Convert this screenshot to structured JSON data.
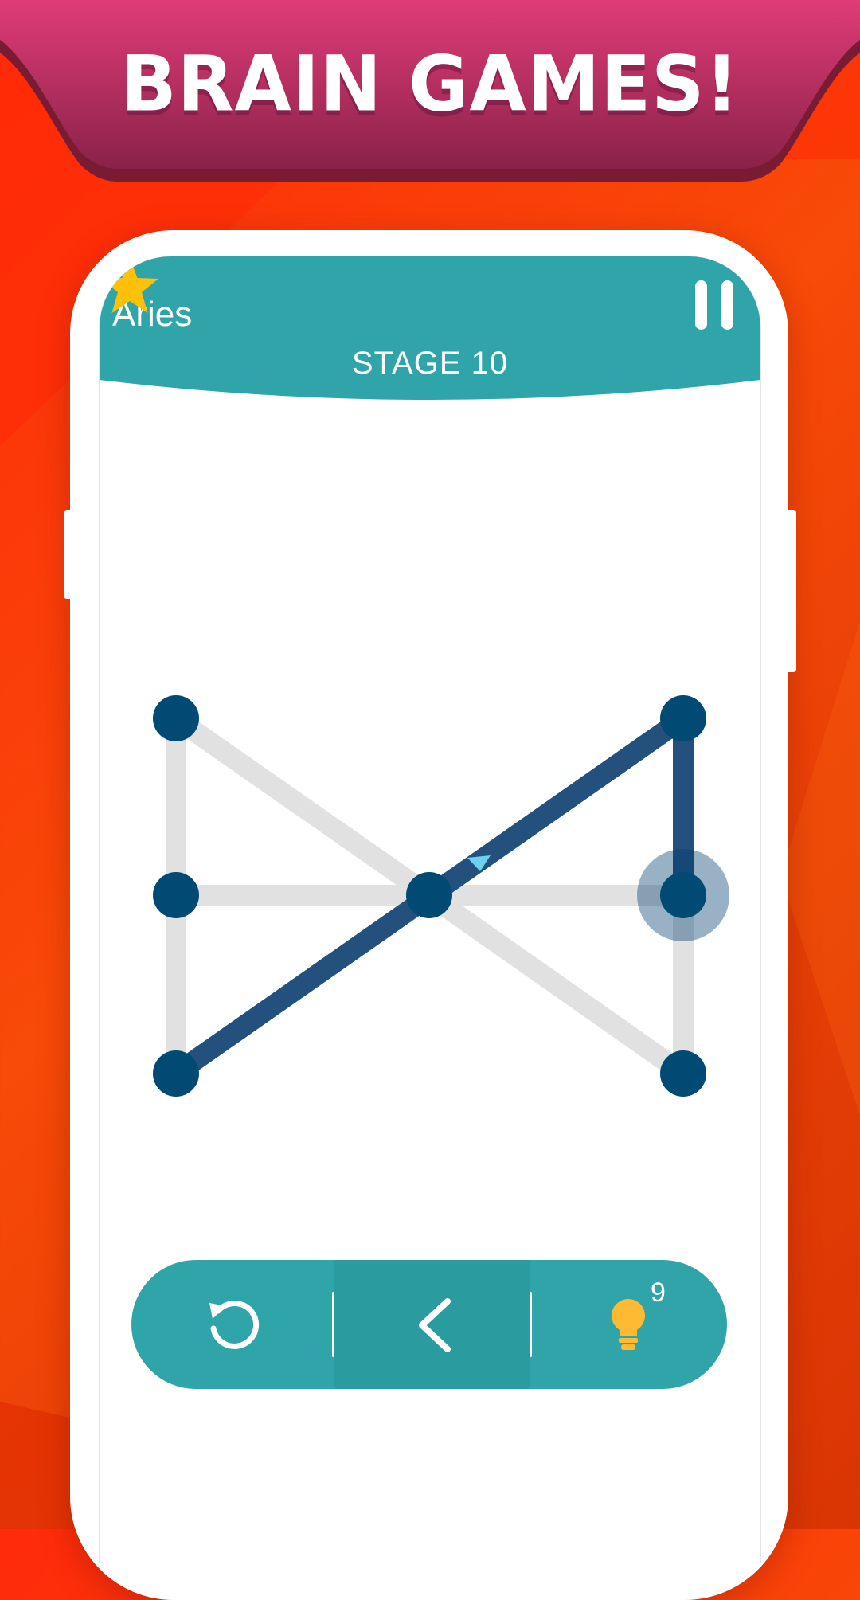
{
  "banner": {
    "title": "BRAIN GAMES!"
  },
  "game": {
    "player_name": "Aries",
    "stage_label": "STAGE 10",
    "hint_count": "9"
  },
  "icons": {
    "star": "star-icon",
    "pause": "pause-icon",
    "undo": "restart-icon",
    "back": "chevron-left-icon",
    "hint": "lightbulb-icon",
    "cursor": "pointer-arrow-icon"
  },
  "colors": {
    "background": "#ff3d0a",
    "banner": "#c5336a",
    "header": "#2fa5aa",
    "dot": "#004a73",
    "drawn_line": "#23507d",
    "guide_line": "#e1e1e1",
    "star": "#ffc107",
    "bulb": "#ffba33"
  }
}
